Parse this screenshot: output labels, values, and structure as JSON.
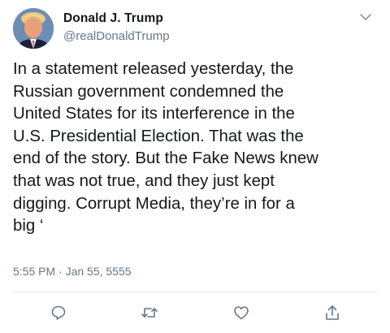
{
  "tweet": {
    "author_name": "Donald J. Trump",
    "author_handle": "@realDonaldTrump",
    "text": "In a statement released yesterday, the\nRussian government condemned the\nUnited States for its interference in the\nU.S. Presidential Election. That was the\nend of the story. But the Fake News knew\nthat was not true, and they just kept\ndigging. Corrupt Media, they’re in for a\nbig ‘",
    "timestamp": "5:55 PM · Jan 55, 5555"
  },
  "icons": {
    "avatar": "profile-photo",
    "menu": "chevron-down-icon",
    "reply": "reply-icon",
    "retweet": "retweet-icon",
    "like": "like-icon",
    "share": "share-icon"
  },
  "colors": {
    "text": "#14171a",
    "secondary": "#657786",
    "divider": "#e1e8ed"
  }
}
